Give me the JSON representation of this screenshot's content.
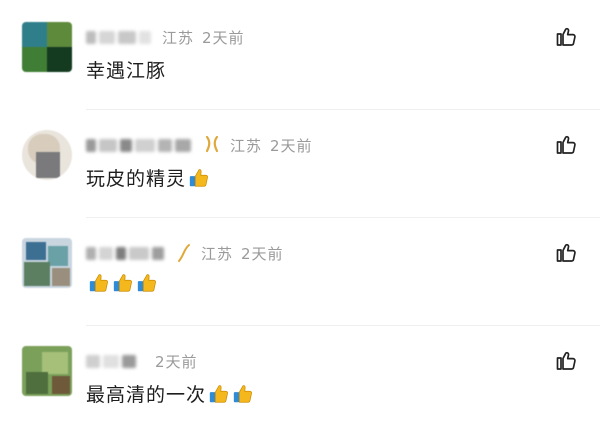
{
  "comments": [
    {
      "name": "",
      "location": "江苏",
      "time": "2天前",
      "text": "幸遇江豚",
      "thumbs": 0,
      "has_badge": false
    },
    {
      "name": "",
      "location": "江苏",
      "time": "2天前",
      "text": "玩皮的精灵",
      "thumbs": 1,
      "has_badge": true
    },
    {
      "name": "",
      "location": "江苏",
      "time": "2天前",
      "text": "",
      "thumbs": 3,
      "has_badge": true
    },
    {
      "name": "",
      "location": "",
      "time": "2天前",
      "text": "最高清的一次",
      "thumbs": 2,
      "has_badge": false
    }
  ],
  "icons": {
    "like": "thumbs-up-outline-icon",
    "emoji": "thumbs-up-emoji-icon",
    "badge": "gold-ribbon-badge-icon"
  },
  "colors": {
    "meta_text": "#9a9a9a",
    "body_text": "#1e1e1e",
    "emoji_yellow": "#f5b81c",
    "emoji_sleeve": "#2f8bd6",
    "badge_gold": "#e0a83a"
  }
}
